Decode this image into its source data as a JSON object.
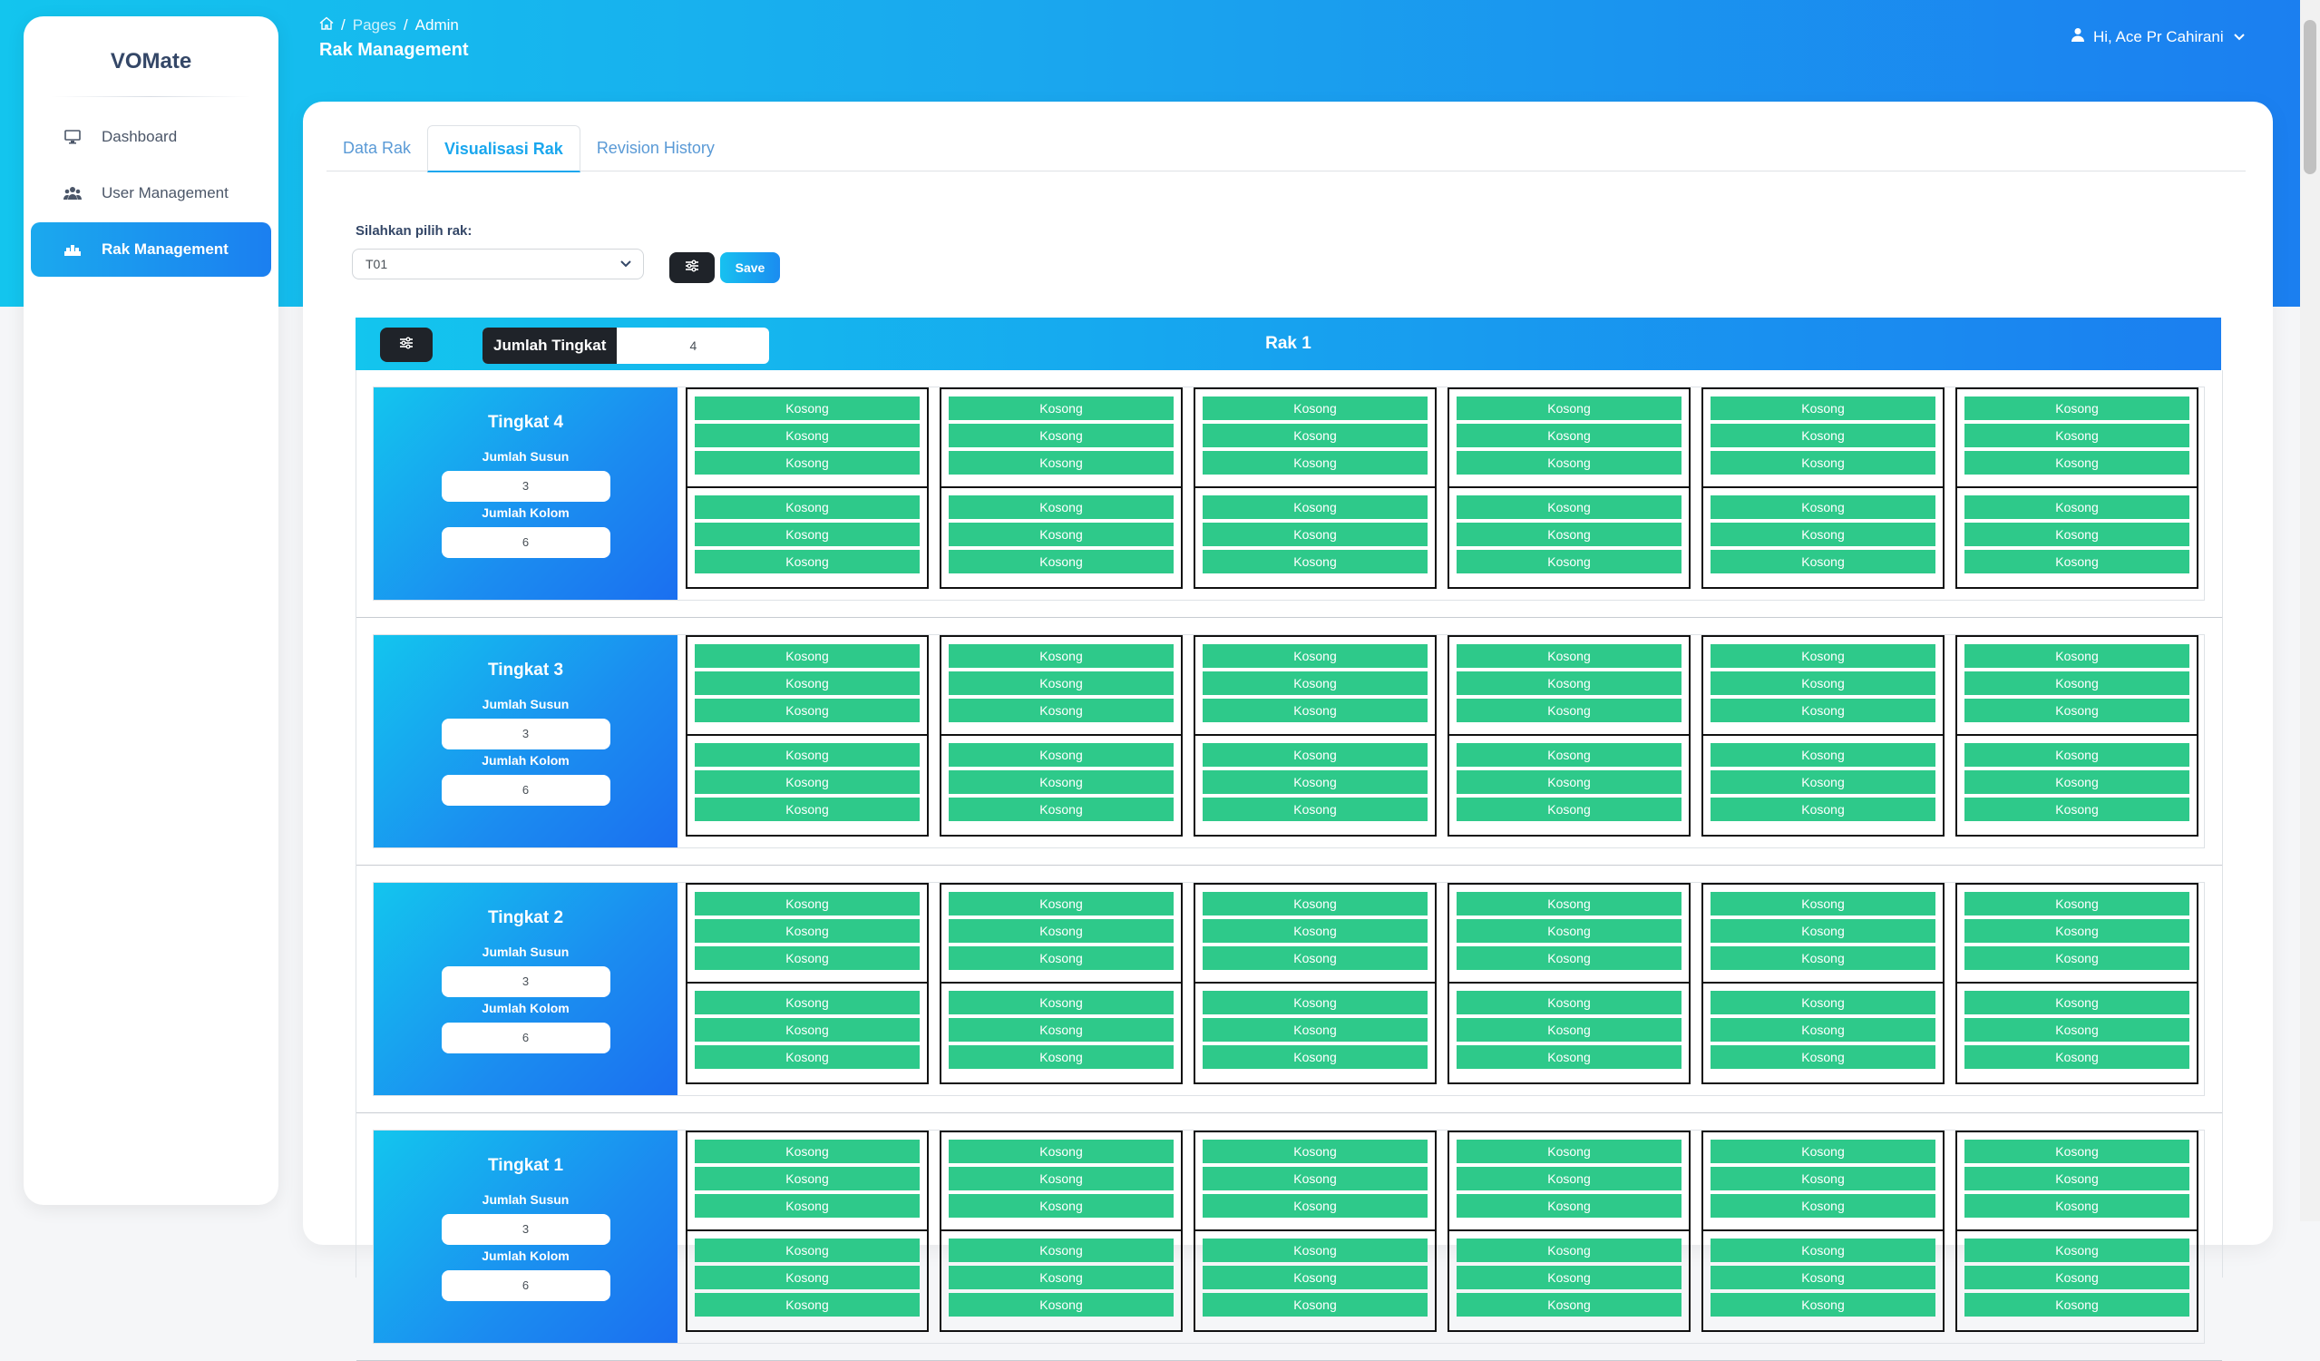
{
  "app": {
    "brand": "VOMate"
  },
  "sidebar": {
    "items": [
      {
        "label": "Dashboard",
        "icon": "monitor-icon"
      },
      {
        "label": "User Management",
        "icon": "users-icon"
      },
      {
        "label": "Rak Management",
        "icon": "warehouse-icon",
        "active": true
      }
    ]
  },
  "header": {
    "breadcrumb": {
      "sep": "/",
      "pages": "Pages",
      "current": "Admin"
    },
    "title": "Rak Management",
    "user": "Hi, Ace Pr  Cahirani"
  },
  "tabs": [
    {
      "label": "Data Rak"
    },
    {
      "label": "Visualisasi Rak",
      "active": true
    },
    {
      "label": "Revision History"
    }
  ],
  "form": {
    "pick_label": "Silahkan pilih rak:",
    "selected_rack": "T01",
    "save_label": "Save"
  },
  "rack": {
    "title": "Rak 1",
    "jumlah_tingkat_label": "Jumlah Tingkat",
    "jumlah_tingkat_value": "4",
    "susun_label": "Jumlah Susun",
    "kolom_label": "Jumlah Kolom",
    "slot_label": "Kosong",
    "levels": [
      {
        "title": "Tingkat 4",
        "susun": "3",
        "kolom": "6"
      },
      {
        "title": "Tingkat 3",
        "susun": "3",
        "kolom": "6"
      },
      {
        "title": "Tingkat 2",
        "susun": "3",
        "kolom": "6"
      },
      {
        "title": "Tingkat 1",
        "susun": "3",
        "kolom": "6"
      }
    ]
  },
  "colors": {
    "accent": "#1aa7ee",
    "slot": "#2ec98a",
    "dark_button": "#1f2329"
  }
}
